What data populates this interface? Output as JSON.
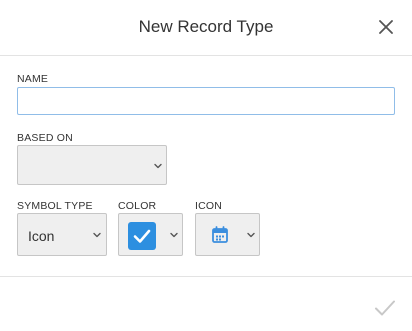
{
  "dialog": {
    "title": "New Record Type",
    "close_icon": "close-icon"
  },
  "fields": {
    "name": {
      "label": "NAME",
      "value": "",
      "placeholder": ""
    },
    "based_on": {
      "label": "BASED ON",
      "value": ""
    },
    "symbol_type": {
      "label": "SYMBOL TYPE",
      "value": "Icon"
    },
    "color": {
      "label": "COLOR",
      "value": "#2d8fe0",
      "swatch_icon": "check-icon"
    },
    "icon": {
      "label": "ICON",
      "value": "calendar-icon",
      "icon_color": "#3b8ede"
    }
  },
  "footer": {
    "ok_icon": "check-icon"
  },
  "colors": {
    "accent": "#2d8fe0",
    "input_border_focus": "#90bde8",
    "select_bg": "#efefef",
    "divider": "#e3e3e3",
    "ok_icon_disabled": "#c8c8c8"
  }
}
